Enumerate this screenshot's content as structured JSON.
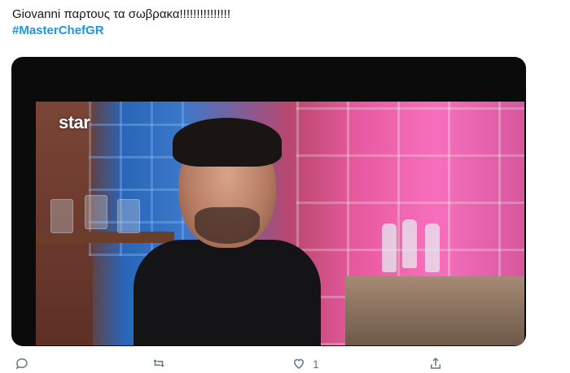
{
  "tweet": {
    "text": "Giovanni παρτους τα σωβρακα!!!!!!!!!!!!!!!",
    "hashtag": "#MasterChefGR"
  },
  "media": {
    "logo_text": "star"
  },
  "actions": {
    "like_count": "1"
  }
}
